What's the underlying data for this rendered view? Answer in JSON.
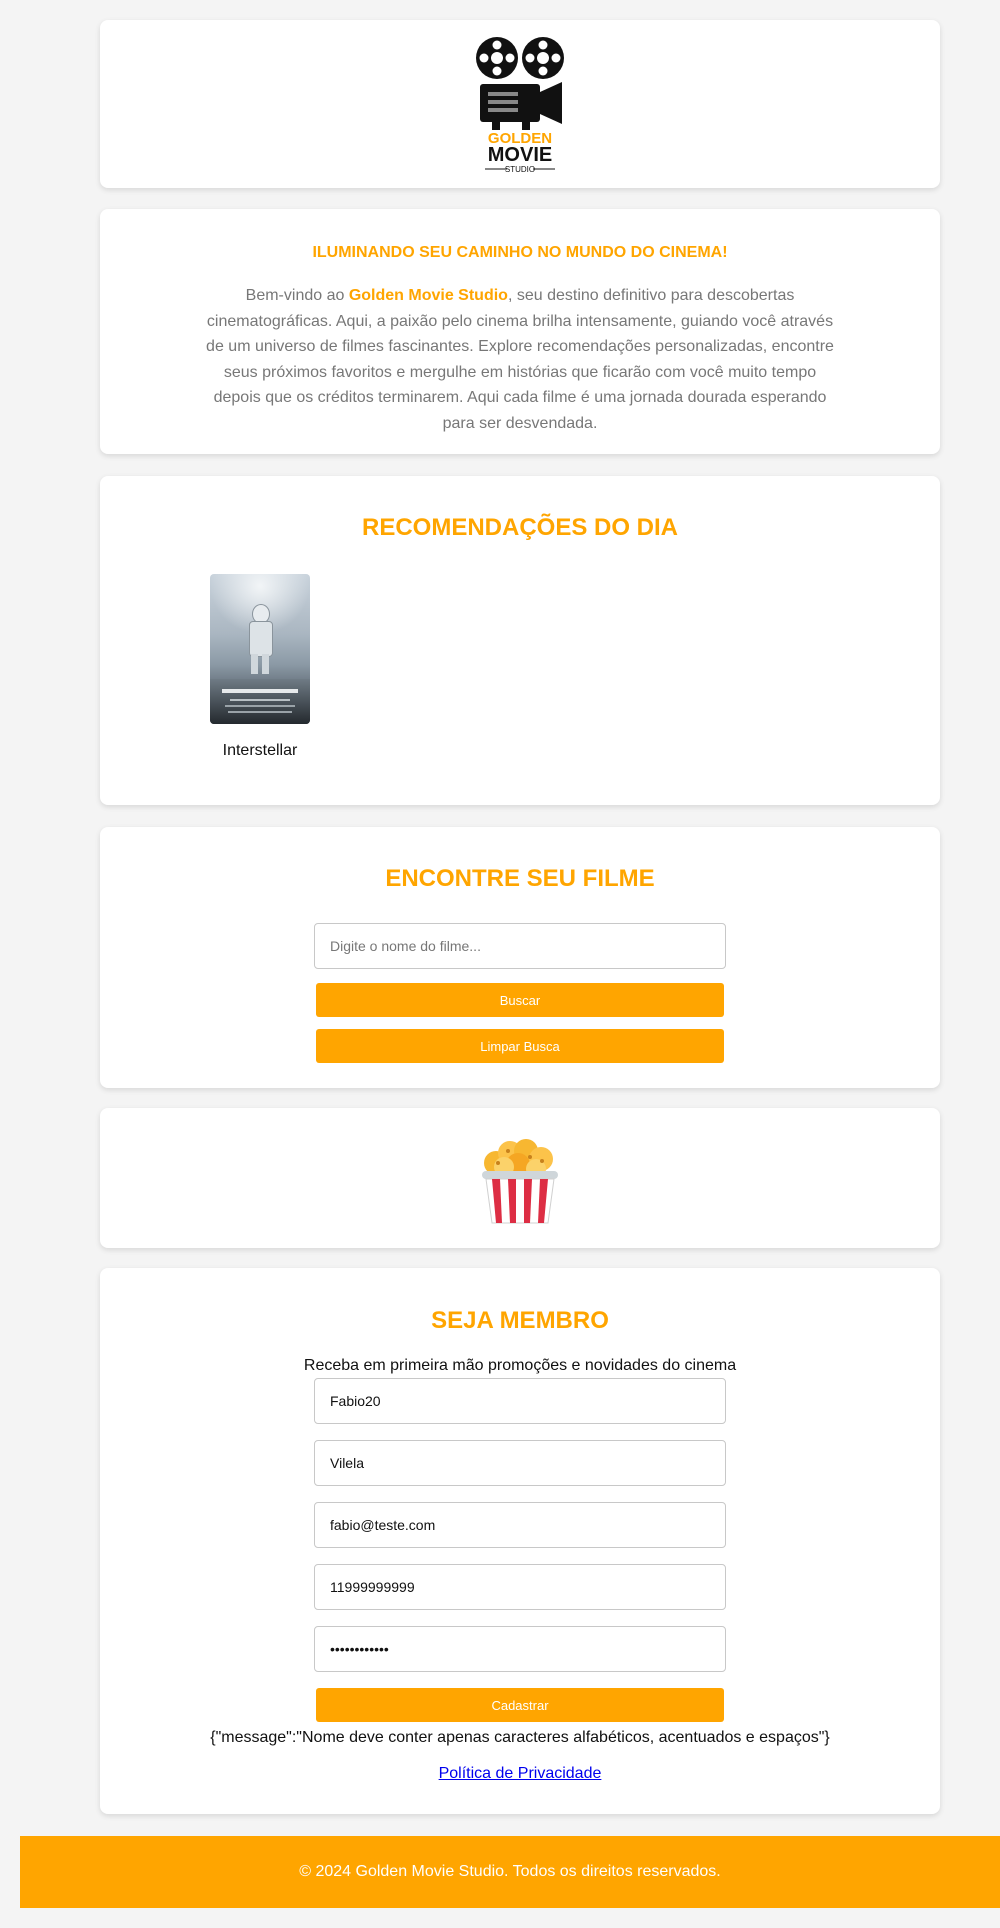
{
  "brand": {
    "logo_top": "GOLDEN",
    "logo_main": "MOVIE",
    "logo_sub": "STUDIO"
  },
  "intro": {
    "headline": "ILUMINANDO SEU CAMINHO NO MUNDO DO CINEMA!",
    "text_before": "Bem-vindo ao ",
    "brand_name": "Golden Movie Studio",
    "text_after": ", seu destino definitivo para descobertas cinematográficas. Aqui, a paixão pelo cinema brilha intensamente, guiando você através de um universo de filmes fascinantes. Explore recomendações personalizadas, encontre seus próximos favoritos e mergulhe em histórias que ficarão com você muito tempo depois que os créditos terminarem. Aqui cada filme é uma jornada dourada esperando para ser desvendada."
  },
  "recommendations": {
    "title": "RECOMENDAÇÕES DO DIA",
    "movies": [
      {
        "title": "Interstellar"
      }
    ]
  },
  "search": {
    "title": "ENCONTRE SEU FILME",
    "placeholder": "Digite o nome do filme...",
    "search_button": "Buscar",
    "clear_button": "Limpar Busca"
  },
  "membership": {
    "title": "SEJA MEMBRO",
    "subtitle": "Receba em primeira mão promoções e novidades do cinema",
    "first_name": "Fabio20",
    "last_name": "Vilela",
    "email": "fabio@teste.com",
    "phone": "11999999999",
    "password": "abcdefghijkl",
    "submit_button": "Cadastrar",
    "response_message": "{\"message\":\"Nome deve conter apenas caracteres alfabéticos, acentuados e espaços\"}",
    "privacy_link": "Política de Privacidade"
  },
  "footer": {
    "text": "© 2024 Golden Movie Studio. Todos os direitos reservados."
  },
  "colors": {
    "accent": "#ffa500",
    "link": "#0000ee",
    "body_text": "#777777"
  },
  "icons": [
    "film-projector-logo-icon",
    "popcorn-icon"
  ]
}
